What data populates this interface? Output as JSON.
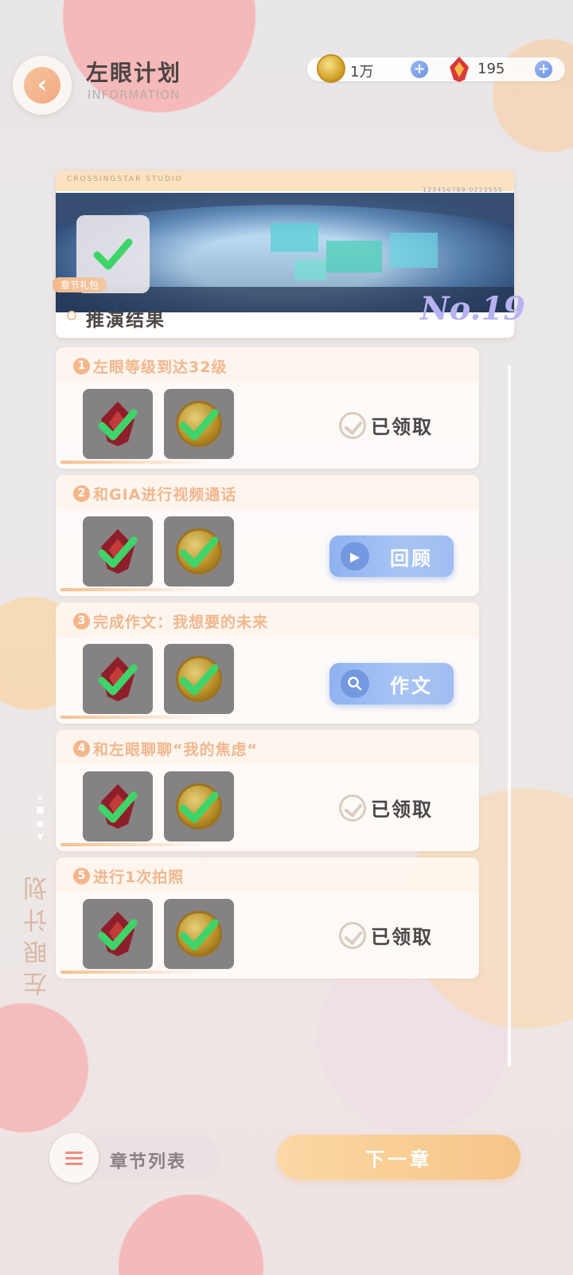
{
  "header": {
    "title": "左眼计划",
    "subtitle": "INFORMATION"
  },
  "currency": {
    "coin_value": "1万",
    "gem_value": "195",
    "plus_symbol": "+"
  },
  "banner": {
    "studio": "CROSSINGSTAR STUDIO",
    "code": "123456789:0223555",
    "gift_label": "章节礼包",
    "result_title": "推演结果",
    "chapter_no": "No.19"
  },
  "tasks": [
    {
      "num": "1",
      "title": "左眼等级到达32级",
      "status": "claimed",
      "status_label": "已领取"
    },
    {
      "num": "2",
      "title": "和GIA进行视频通话",
      "status": "action",
      "action_label": "回顾",
      "action_icon": "play-icon"
    },
    {
      "num": "3",
      "title": "完成作文：我想要的未来",
      "status": "action",
      "action_label": "作文",
      "action_icon": "search-icon"
    },
    {
      "num": "4",
      "title": "和左眼聊聊“我的焦虑“",
      "status": "claimed",
      "status_label": "已领取"
    },
    {
      "num": "5",
      "title": "进行1次拍照",
      "status": "claimed",
      "status_label": "已领取"
    }
  ],
  "side_label": "左眼计划",
  "footer": {
    "chapter_list_label": "章节列表",
    "next_label": "下一章"
  },
  "colors": {
    "accent_orange": "#f1b78e",
    "button_blue": "#9fbdf1",
    "check_green": "#3ed46a"
  }
}
